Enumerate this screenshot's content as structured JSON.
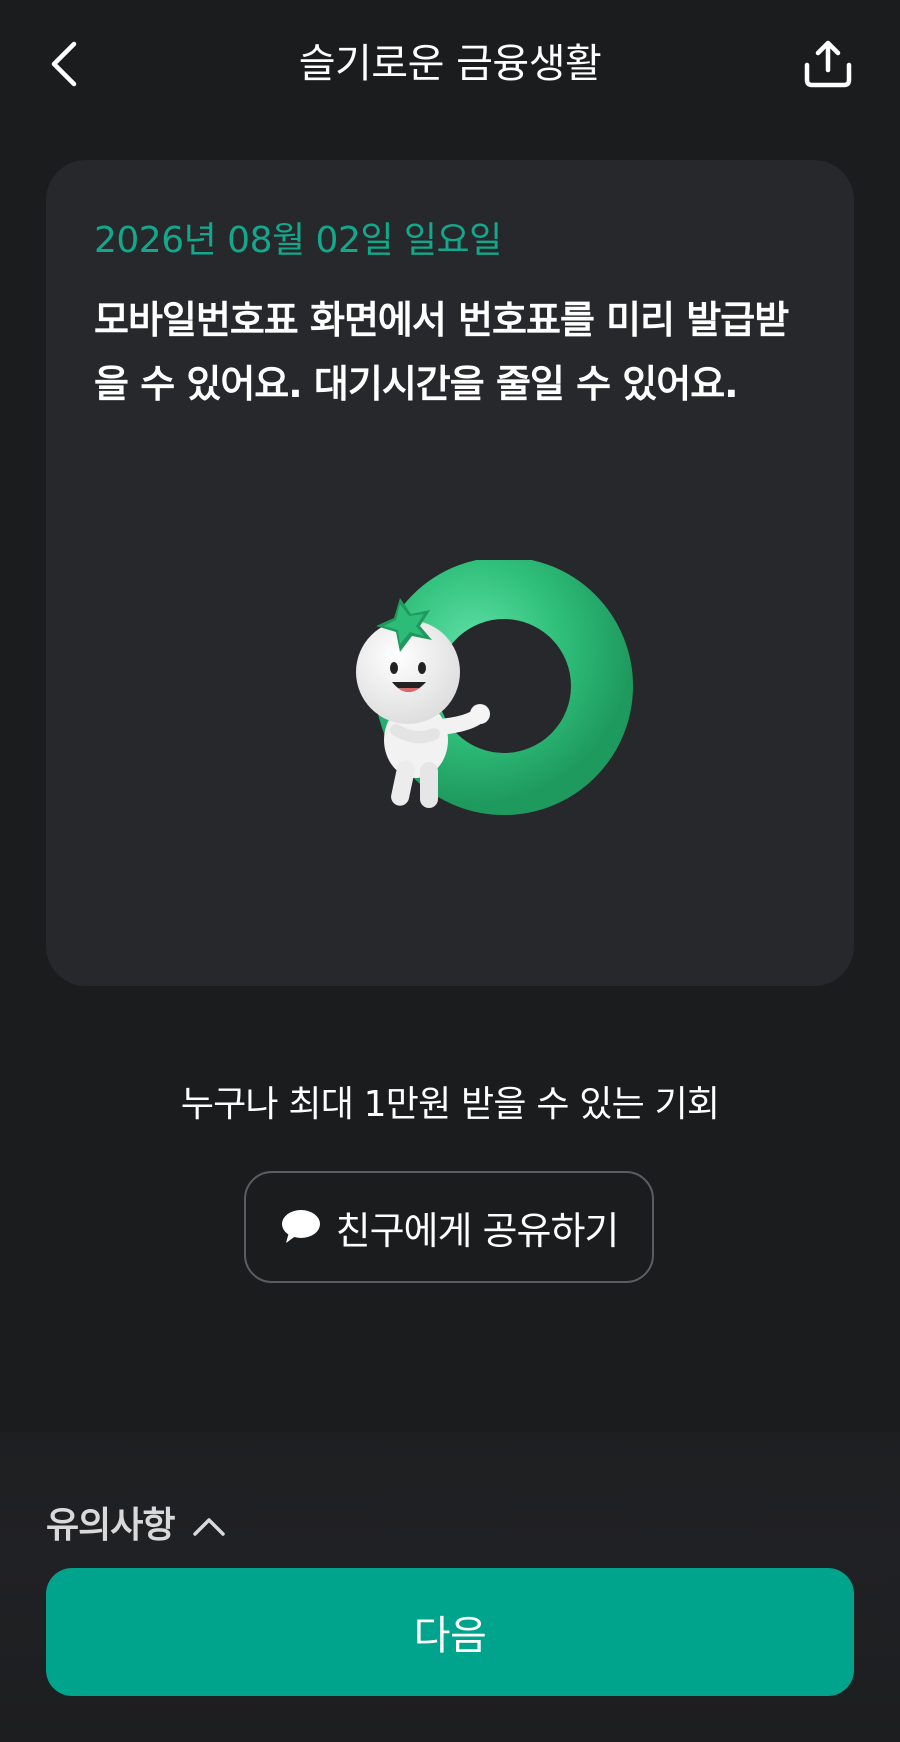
{
  "header": {
    "title": "슬기로운 금융생활",
    "back_icon": "chevron-left-icon",
    "share_icon": "upload-share-icon"
  },
  "card": {
    "date": "2026년 08월 02일 일요일",
    "message": "모바일번호표 화면에서 번호표를 미리 발급받을 수 있어요. 대기시간을 줄일 수 있어요.",
    "illustration": "mascot-with-green-ring"
  },
  "promo": {
    "text": "누구나 최대 1만원 받을 수 있는 기회"
  },
  "share_friend": {
    "label": "친구에게 공유하기",
    "icon": "chat-bubble-icon"
  },
  "notice": {
    "label": "유의사항",
    "icon": "chevron-up-icon"
  },
  "footer": {
    "next_label": "다음"
  },
  "colors": {
    "background": "#1b1c1e",
    "card": "#27282b",
    "accent": "#13a88c",
    "button": "#00a38b"
  }
}
